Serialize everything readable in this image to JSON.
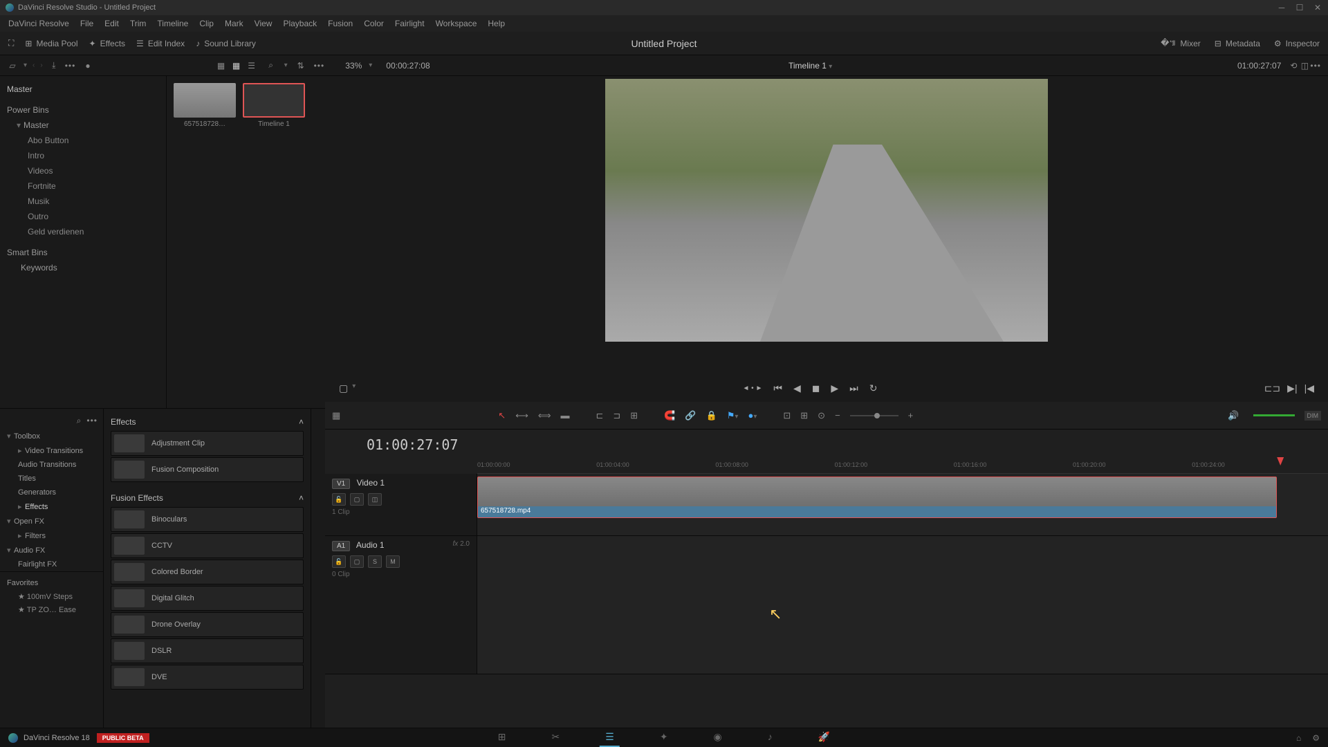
{
  "titlebar": {
    "text": "DaVinci Resolve Studio - Untitled Project"
  },
  "menubar": [
    "DaVinci Resolve",
    "File",
    "Edit",
    "Trim",
    "Timeline",
    "Clip",
    "Mark",
    "View",
    "Playback",
    "Fusion",
    "Color",
    "Fairlight",
    "Workspace",
    "Help"
  ],
  "toolbar": {
    "media_pool": "Media Pool",
    "effects": "Effects",
    "edit_index": "Edit Index",
    "sound_library": "Sound Library",
    "mixer": "Mixer",
    "metadata": "Metadata",
    "inspector": "Inspector"
  },
  "project_title": "Untitled Project",
  "sub_toolbar": {
    "zoom": "33%",
    "tc_left": "00:00:27:08",
    "timeline_name": "Timeline 1",
    "tc_right": "01:00:27:07"
  },
  "media_tree": {
    "master": "Master",
    "power_bins": "Power Bins",
    "pb_master": "Master",
    "items": [
      "Abo Button",
      "Intro",
      "Videos",
      "Fortnite",
      "Musik",
      "Outro",
      "Geld verdienen"
    ],
    "smart_bins": "Smart Bins",
    "keywords": "Keywords"
  },
  "thumbs": {
    "clip1": "657518728…",
    "clip2": "Timeline 1"
  },
  "fx_tree": {
    "toolbox": "Toolbox",
    "video_trans": "Video Transitions",
    "audio_trans": "Audio Transitions",
    "titles": "Titles",
    "generators": "Generators",
    "effects": "Effects",
    "openfx": "Open FX",
    "filters": "Filters",
    "audiofx": "Audio FX",
    "fairlight": "Fairlight FX"
  },
  "fx_list": {
    "header1": "Effects",
    "adjustment": "Adjustment Clip",
    "fusion_comp": "Fusion Composition",
    "header2": "Fusion Effects",
    "items": [
      "Binoculars",
      "CCTV",
      "Colored Border",
      "Digital Glitch",
      "Drone Overlay",
      "DSLR",
      "DVE"
    ]
  },
  "favorites": {
    "header": "Favorites",
    "items": [
      "100mV Steps",
      "TP ZO… Ease"
    ]
  },
  "timeline": {
    "big_tc": "01:00:27:07",
    "ticks": [
      "01:00:00:00",
      "01:00:04:00",
      "01:00:08:00",
      "01:00:12:00",
      "01:00:16:00",
      "01:00:20:00",
      "01:00:24:00"
    ],
    "v1_tag": "V1",
    "v1_name": "Video 1",
    "v1_count": "1 Clip",
    "a1_tag": "A1",
    "a1_name": "Audio 1",
    "a1_count": "0 Clip",
    "a1_fx": "fx",
    "a1_val": "2.0",
    "clip_name": "657518728.mp4",
    "solo": "S",
    "mute": "M",
    "dim": "DIM"
  },
  "bottom": {
    "app": "DaVinci Resolve 18",
    "badge": "PUBLIC BETA"
  }
}
